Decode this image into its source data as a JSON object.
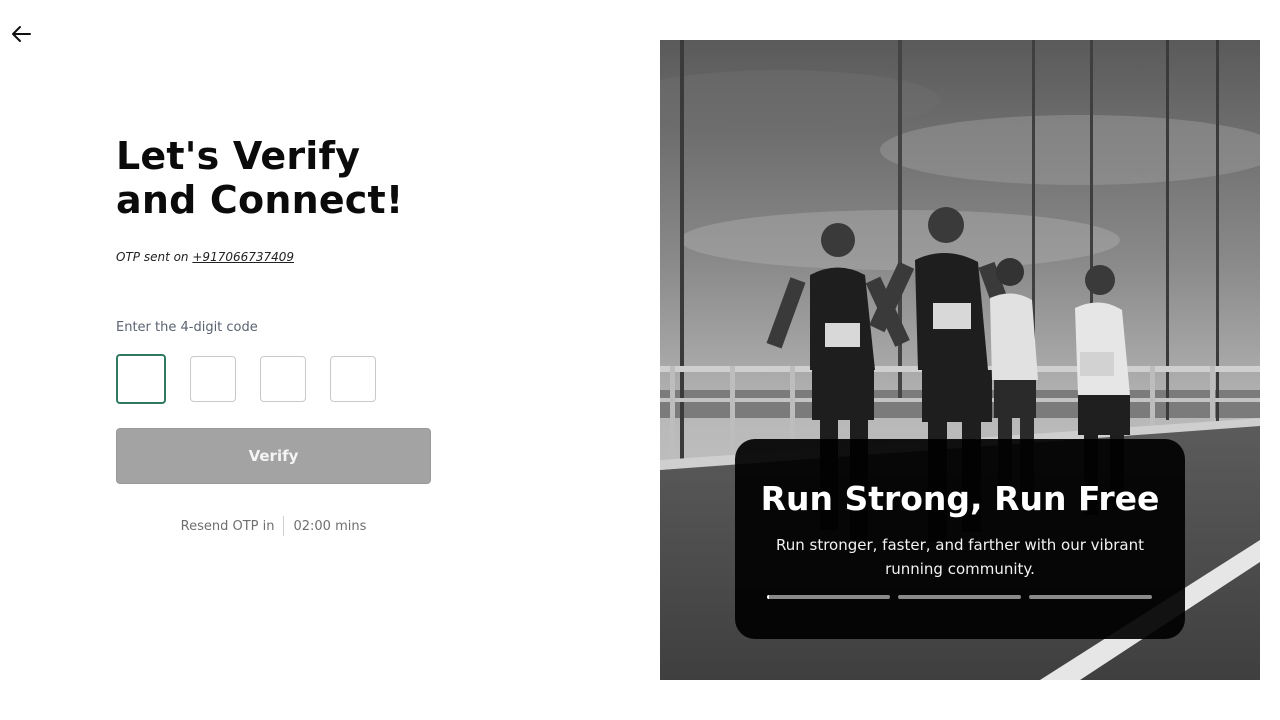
{
  "header": {
    "back_icon": "arrow-left-icon"
  },
  "form": {
    "title": "Let's Verify and Connect!",
    "otp_sent_prefix": "OTP sent on",
    "phone": "+917066737409",
    "code_label": "Enter the 4-digit code",
    "otp_digits": [
      "",
      "",
      "",
      ""
    ],
    "verify_label": "Verify",
    "resend_label": "Resend OTP in",
    "resend_timer": "02:00 mins"
  },
  "colors": {
    "active_otp_border": "#2f7a5e",
    "verify_disabled_bg": "#a3a3a3"
  },
  "hero": {
    "title": "Run Strong, Run Free",
    "subtitle": "Run stronger, faster, and farther with our vibrant running community.",
    "slides": [
      {
        "progress": 0.02
      },
      {
        "progress": 0
      },
      {
        "progress": 0
      }
    ]
  }
}
